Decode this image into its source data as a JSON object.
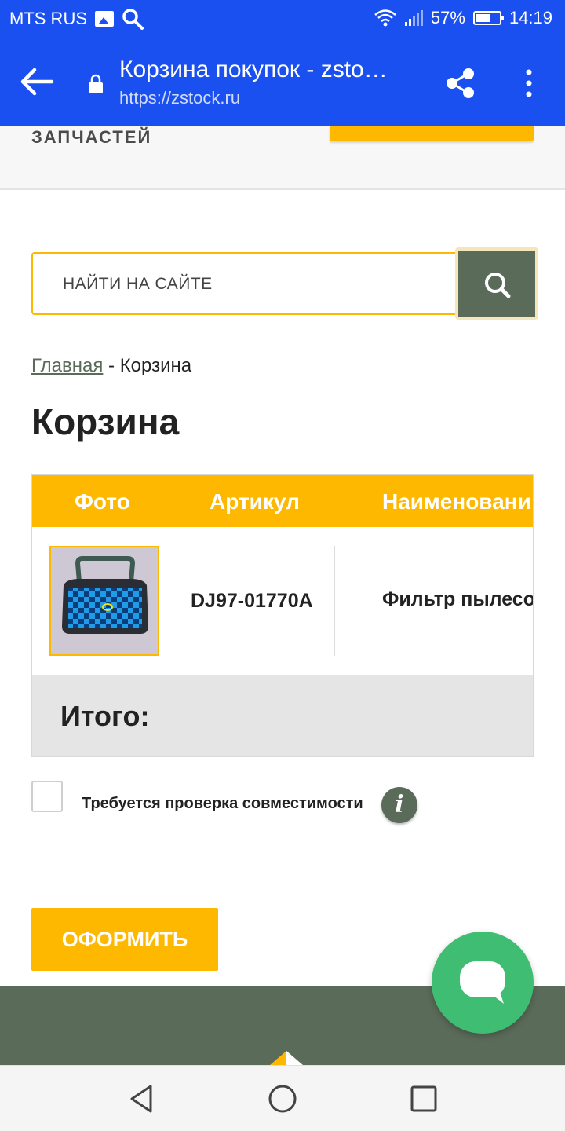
{
  "status_bar": {
    "carrier": "MTS RUS",
    "battery": "57%",
    "time": "14:19"
  },
  "browser": {
    "page_title": "Корзина покупок - zsto…",
    "url": "https://zstock.ru"
  },
  "header": {
    "logo_text": "ЗАПЧАСТЕЙ"
  },
  "search": {
    "placeholder": "НАЙТИ НА САЙТЕ"
  },
  "breadcrumb": {
    "home": "Главная",
    "separator": " - ",
    "current": "Корзина"
  },
  "page": {
    "title": "Корзина"
  },
  "cart": {
    "columns": [
      "Фото",
      "Артикул",
      "Наименовани"
    ],
    "items": [
      {
        "article": "DJ97-01770A",
        "name": "Фильтр пылесос"
      }
    ],
    "total_label": "Итого:"
  },
  "compatibility": {
    "label": "Требуется проверка совместимости",
    "info_glyph": "i",
    "checked": false
  },
  "checkout": {
    "label": "ОФОРМИТЬ"
  },
  "colors": {
    "brand_yellow": "#ffb800",
    "brand_green": "#5b6b59",
    "chrome_blue": "#1a4ff0",
    "chat_green": "#3fbd73"
  }
}
